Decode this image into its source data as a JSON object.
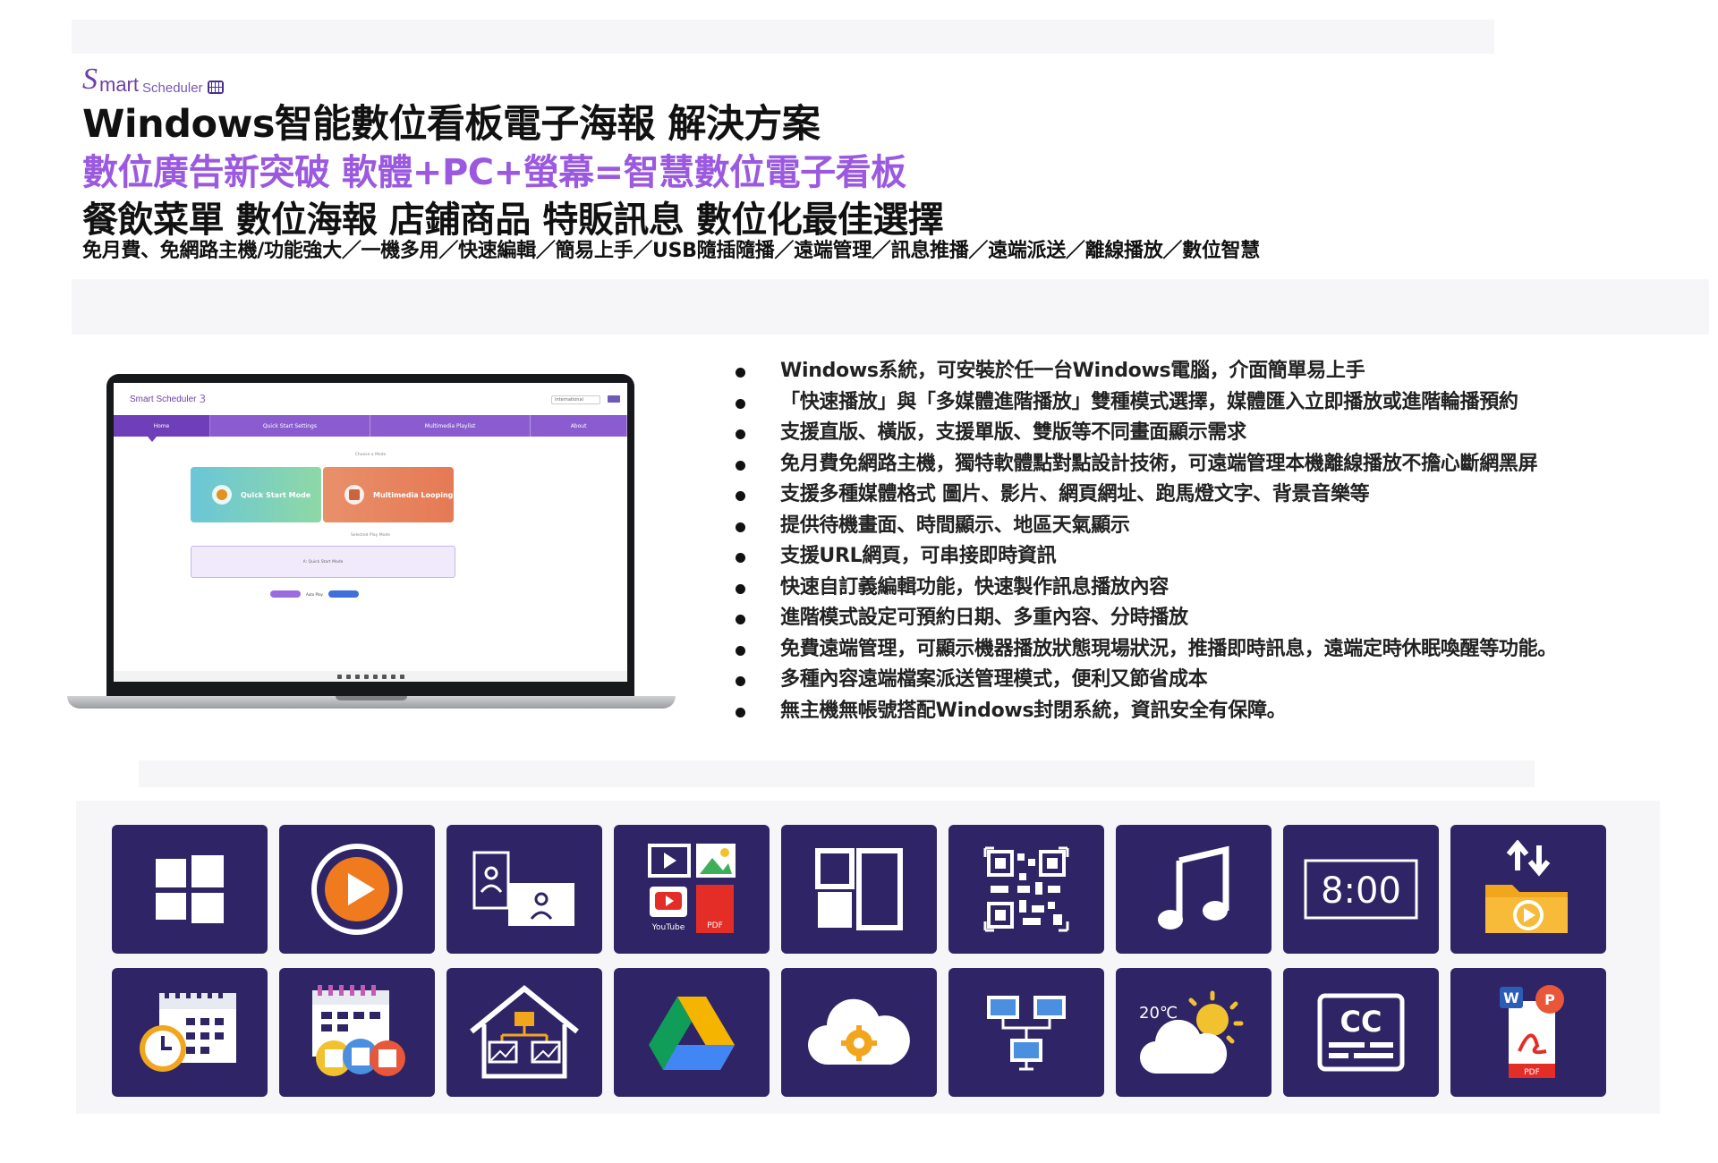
{
  "header": {
    "logo_text": "Smart Scheduler",
    "title": "Windows智能數位看板電子海報 解決方案",
    "subtitle": "數位廣告新突破 軟體+PC+螢幕=智慧數位電子看板",
    "tagline": "餐飲菜單 數位海報 店鋪商品 特販訊息 數位化最佳選擇",
    "features_line": "免月費、免網路主機/功能強大／一機多用／快速編輯／簡易上手／USB隨插隨播／遠端管理／訊息推播／遠端派送／離線播放／數位智慧"
  },
  "app_preview": {
    "logo": "Smart Scheduler",
    "version": "3",
    "lang_select": "International",
    "nav": [
      "Home",
      "Quick Start Settings",
      "Multimedia Playlist",
      "About"
    ],
    "choose_mode": "Choose a Mode",
    "mode_quick": "Quick Start Mode",
    "mode_multi": "Multimedia Looping",
    "selected_play_mode": "Selected Play Mode",
    "selected_value": "A: Quick Start Mode",
    "buttons": [
      "Start",
      "Auto Play",
      "Exit"
    ]
  },
  "bullets": [
    "Windows系統，可安裝於任一台Windows電腦，介面簡單易上手",
    "「快速播放」與「多媒體進階播放」雙種模式選擇，媒體匯入立即播放或進階輪播預約",
    "支援直版、橫版，支援單版、雙版等不同畫面顯示需求",
    "免月費免網路主機，獨特軟體點對點設計技術，可遠端管理本機離線播放不擔心斷網黑屏",
    "支援多種媒體格式 圖片、影片、網頁網址、跑馬燈文字、背景音樂等",
    "提供待機畫面、時間顯示、地區天氣顯示",
    "支援URL網頁，可串接即時資訊",
    "快速自訂義編輯功能，快速製作訊息播放內容",
    "進階模式設定可預約日期、多重內容、分時播放",
    "免費遠端管理，可顯示機器播放狀態現場狀況，推播即時訊息，遠端定時休眠喚醒等功能。",
    "多種內容遠端檔案派送管理模式，便利又節省成本",
    "無主機無帳號搭配Windows封閉系統，資訊安全有保障。"
  ],
  "tile_labels": {
    "clock_time": "8:00",
    "weather_temp": "20℃",
    "caption": "CC",
    "youtube": "YouTube",
    "pdf": "PDF",
    "word_letter": "W",
    "ppt_letter": "P"
  },
  "icons": [
    "windows-icon",
    "play-icon",
    "portrait-landscape-icon",
    "media-formats-icon",
    "split-layout-icon",
    "qr-code-icon",
    "music-icon",
    "clock-icon",
    "folder-transfer-icon",
    "calendar-clock-icon",
    "calendar-schedule-icon",
    "remote-home-icon",
    "google-drive-icon",
    "cloud-settings-icon",
    "network-monitors-icon",
    "weather-icon",
    "closed-caption-icon",
    "office-pdf-icon"
  ],
  "colors": {
    "accent_purple": "#9b59e0",
    "tile_background": "#2e2466",
    "nav_purple": "#8a5cd0"
  }
}
